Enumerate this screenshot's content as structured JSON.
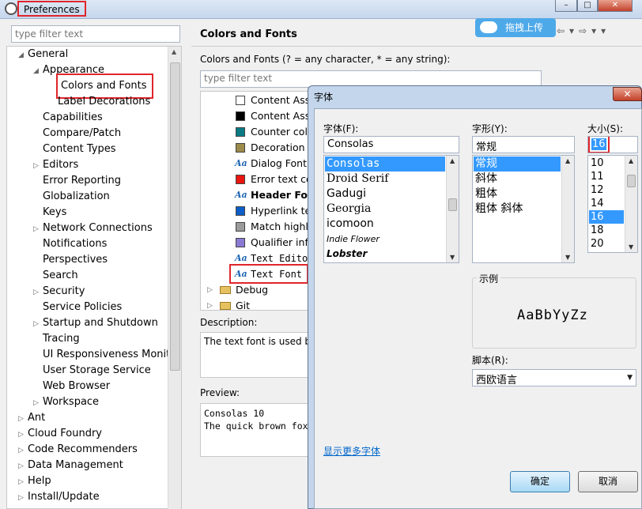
{
  "window": {
    "title": "Preferences",
    "min_glyph": "–",
    "max_glyph": "□",
    "close_glyph": "✕"
  },
  "left": {
    "filter_placeholder": "type filter text",
    "tree": [
      {
        "label": "General",
        "indent": 0,
        "arrow": "◢"
      },
      {
        "label": "Appearance",
        "indent": 1,
        "arrow": "◢"
      },
      {
        "label": "Colors and Fonts",
        "indent": 2,
        "arrow": "",
        "highlight": true
      },
      {
        "label": "Label Decorations",
        "indent": 2,
        "arrow": ""
      },
      {
        "label": "Capabilities",
        "indent": 1,
        "arrow": ""
      },
      {
        "label": "Compare/Patch",
        "indent": 1,
        "arrow": ""
      },
      {
        "label": "Content Types",
        "indent": 1,
        "arrow": ""
      },
      {
        "label": "Editors",
        "indent": 1,
        "arrow": "▷"
      },
      {
        "label": "Error Reporting",
        "indent": 1,
        "arrow": ""
      },
      {
        "label": "Globalization",
        "indent": 1,
        "arrow": ""
      },
      {
        "label": "Keys",
        "indent": 1,
        "arrow": ""
      },
      {
        "label": "Network Connections",
        "indent": 1,
        "arrow": "▷"
      },
      {
        "label": "Notifications",
        "indent": 1,
        "arrow": ""
      },
      {
        "label": "Perspectives",
        "indent": 1,
        "arrow": ""
      },
      {
        "label": "Search",
        "indent": 1,
        "arrow": ""
      },
      {
        "label": "Security",
        "indent": 1,
        "arrow": "▷"
      },
      {
        "label": "Service Policies",
        "indent": 1,
        "arrow": ""
      },
      {
        "label": "Startup and Shutdown",
        "indent": 1,
        "arrow": "▷"
      },
      {
        "label": "Tracing",
        "indent": 1,
        "arrow": ""
      },
      {
        "label": "UI Responsiveness Monito",
        "indent": 1,
        "arrow": ""
      },
      {
        "label": "User Storage Service",
        "indent": 1,
        "arrow": ""
      },
      {
        "label": "Web Browser",
        "indent": 1,
        "arrow": ""
      },
      {
        "label": "Workspace",
        "indent": 1,
        "arrow": "▷"
      },
      {
        "label": "Ant",
        "indent": 0,
        "arrow": "▷"
      },
      {
        "label": "Cloud Foundry",
        "indent": 0,
        "arrow": "▷"
      },
      {
        "label": "Code Recommenders",
        "indent": 0,
        "arrow": "▷"
      },
      {
        "label": "Data Management",
        "indent": 0,
        "arrow": "▷"
      },
      {
        "label": "Help",
        "indent": 0,
        "arrow": "▷"
      },
      {
        "label": "Install/Update",
        "indent": 0,
        "arrow": "▷"
      }
    ]
  },
  "right": {
    "title": "Colors and Fonts",
    "description": "Colors and Fonts (? = any character, * = any string):",
    "filter_placeholder": "type filter text",
    "items": [
      {
        "label": "Content Assi",
        "kind": "swatch",
        "color": "#ffffff"
      },
      {
        "label": "Content Assi",
        "kind": "swatch",
        "color": "#000000"
      },
      {
        "label": "Counter colo",
        "kind": "swatch",
        "color": "#0a7b85"
      },
      {
        "label": "Decoration c",
        "kind": "swatch",
        "color": "#9c8a4a"
      },
      {
        "label": "Dialog Font",
        "kind": "font"
      },
      {
        "label": "Error text co",
        "kind": "swatch",
        "color": "#e8160f"
      },
      {
        "label": "Header Font",
        "kind": "font",
        "bold": true
      },
      {
        "label": "Hyperlink tex",
        "kind": "swatch",
        "color": "#0b5dc7"
      },
      {
        "label": "Match highli",
        "kind": "swatch",
        "color": "#9b9b9b"
      },
      {
        "label": "Qualifier info",
        "kind": "swatch",
        "color": "#8b7ad4"
      },
      {
        "label": "Text Editor",
        "kind": "font",
        "mono": true
      },
      {
        "label": "Text Font",
        "kind": "font",
        "mono": true,
        "highlight": true
      }
    ],
    "folders": [
      {
        "label": "Debug"
      },
      {
        "label": "Git"
      }
    ],
    "font_icon_glyph": "Aa",
    "desc_label": "Description:",
    "desc_text": "The text font is used by",
    "preview_label": "Preview:",
    "preview_line1": "Consolas 10",
    "preview_line2": "The quick brown fox",
    "upload_label": "拖拽上传"
  },
  "dialog": {
    "title": "字体",
    "font_label": "字体(F):",
    "font_value": "Consolas",
    "fonts": [
      "Consolas",
      "Droid Serif",
      "Gadugi",
      "Georgia",
      "icomoon",
      "Indie Flower",
      "Lobster"
    ],
    "style_label": "字形(Y):",
    "style_value": "常规",
    "styles": [
      "常规",
      "斜体",
      "粗体",
      "粗体 斜体"
    ],
    "size_label": "大小(S):",
    "size_value": "16",
    "sizes": [
      "10",
      "11",
      "12",
      "14",
      "16",
      "18",
      "20"
    ],
    "sample_label": "示例",
    "sample_text": "AaBbYyZz",
    "script_label": "脚本(R):",
    "script_value": "西欧语言",
    "more_fonts_link": "显示更多字体",
    "ok_button": "确定",
    "cancel_button": "取消"
  }
}
